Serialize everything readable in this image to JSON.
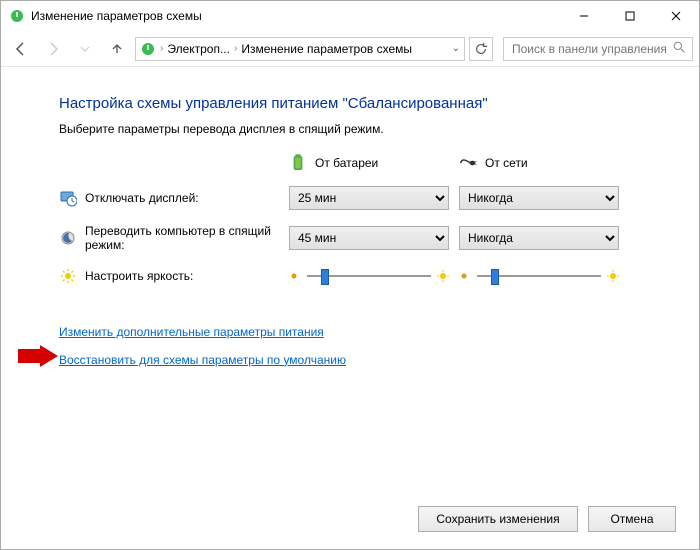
{
  "window": {
    "title": "Изменение параметров схемы"
  },
  "breadcrumb": {
    "item1": "Электроп...",
    "item2": "Изменение параметров схемы"
  },
  "search": {
    "placeholder": "Поиск в панели управления"
  },
  "page": {
    "heading": "Настройка схемы управления питанием \"Сбалансированная\"",
    "sub": "Выберите параметры перевода дисплея в спящий режим."
  },
  "columns": {
    "battery": "От батареи",
    "plugged": "От сети"
  },
  "rows": {
    "display": "Отключать дисплей:",
    "sleep": "Переводить компьютер в спящий режим:",
    "brightness": "Настроить яркость:"
  },
  "values": {
    "display_battery": "25 мин",
    "display_plugged": "Никогда",
    "sleep_battery": "45 мин",
    "sleep_plugged": "Никогда"
  },
  "links": {
    "advanced": "Изменить дополнительные параметры питания",
    "restore": "Восстановить для схемы параметры по умолчанию"
  },
  "buttons": {
    "save": "Сохранить изменения",
    "cancel": "Отмена"
  }
}
